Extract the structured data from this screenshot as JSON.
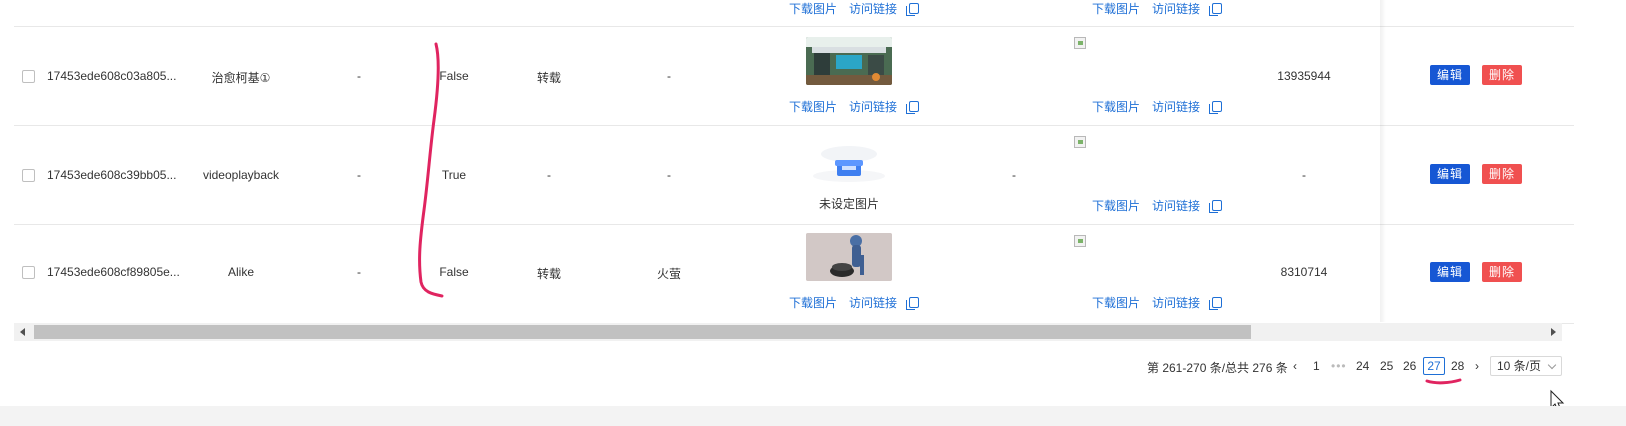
{
  "colors": {
    "link": "#1e6fd6",
    "edit_button": "#1657d4",
    "delete_button": "#f05050",
    "active_page": "#1e6fd6"
  },
  "top_row": {
    "download": "下载图片",
    "visit": "访问链接"
  },
  "rows": [
    {
      "id": "17453ede608c03a805...",
      "name": "治愈柯基①",
      "col3": "-",
      "flag": "False",
      "type": "转载",
      "source": "-",
      "image": "cartoon-shop-thumbnail",
      "col8": "",
      "number": "13935944",
      "download": "下载图片",
      "visit": "访问链接",
      "edit": "编辑",
      "delete": "删除"
    },
    {
      "id": "17453ede608c39bb05...",
      "name": "videoplayback",
      "col3": "-",
      "flag": "True",
      "type": "-",
      "source": "-",
      "image": "no-image-placeholder",
      "no_image_text": "未设定图片",
      "col8": "-",
      "number": "-",
      "download": "下载图片",
      "visit": "访问链接",
      "edit": "编辑",
      "delete": "删除"
    },
    {
      "id": "17453ede608cf89805e...",
      "name": "Alike",
      "col3": "-",
      "flag": "False",
      "type": "转载",
      "source": "火萤",
      "image": "blue-figure-thumbnail",
      "col8": "",
      "number": "8310714",
      "download": "下载图片",
      "visit": "访问链接",
      "edit": "编辑",
      "delete": "删除"
    }
  ],
  "pagination": {
    "total_text": "第 261-270 条/总共 276 条",
    "pages": [
      "1",
      "24",
      "25",
      "26",
      "27",
      "28"
    ],
    "ellipsis": "•••",
    "current": "27",
    "page_size": "10 条/页"
  }
}
